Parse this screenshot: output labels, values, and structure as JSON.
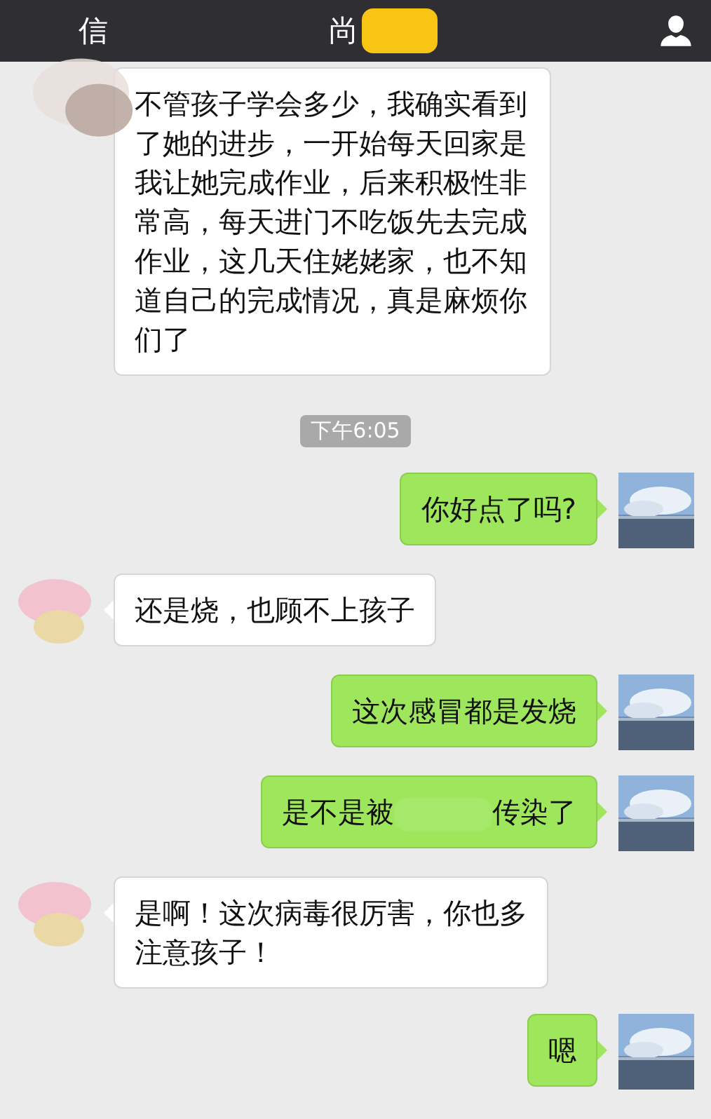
{
  "header": {
    "back": "信",
    "title": "尚"
  },
  "messages": [
    {
      "kind": "received",
      "text": "不管孩子学会多少，我确实看到了她的进步，一开始每天回家是我让她完成作业，后来积极性非常高，每天进门不吃饭先去完成作业，这几天住姥姥家，也不知道自己的完成情况，真是麻烦你们了"
    },
    {
      "kind": "time",
      "text": "下午6:05"
    },
    {
      "kind": "sent",
      "text": "你好点了吗?"
    },
    {
      "kind": "received",
      "text": "还是烧，也顾不上孩子"
    },
    {
      "kind": "sent",
      "text": "这次感冒都是发烧"
    },
    {
      "kind": "sent",
      "parts": [
        "是不是被",
        "传染了"
      ]
    },
    {
      "kind": "received",
      "text": "是啊！这次病毒很厉害，你也多注意孩子！"
    },
    {
      "kind": "sent",
      "text": "嗯"
    }
  ]
}
